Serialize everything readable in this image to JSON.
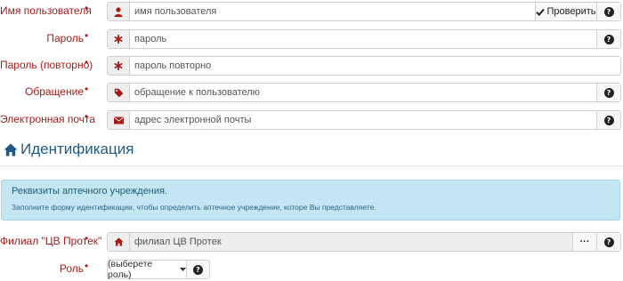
{
  "colors": {
    "label": "#a31d1d",
    "section_title": "#1f5a8a",
    "alert_bg": "#c4e6f3"
  },
  "fields": {
    "username": {
      "label": "Имя пользователя",
      "required": "•",
      "placeholder": "имя пользователя",
      "icon": "user-icon",
      "check_label": "Проверить",
      "help": "?"
    },
    "password": {
      "label": "Пароль",
      "required": "•",
      "placeholder": "пароль",
      "icon": "asterisk-icon",
      "help": "?"
    },
    "password_repeat": {
      "label": "Пароль (повторно)",
      "required": "•",
      "placeholder": "пароль повторно",
      "icon": "asterisk-icon"
    },
    "salutation": {
      "label": "Обращение",
      "required": "•",
      "placeholder": "обращение к пользователю",
      "icon": "tag-icon",
      "help": "?"
    },
    "email": {
      "label": "Электронная почта",
      "required": "•",
      "placeholder": "адрес электронной почты",
      "icon": "envelope-icon",
      "help": "?"
    }
  },
  "section": {
    "title": "Идентификация",
    "icon": "home-icon"
  },
  "alert": {
    "title": "Реквизиты аптечного учреждения.",
    "text": "Заполните форму идентификации, чтобы определить аптечное учреждение, которе Вы представляете."
  },
  "branch": {
    "label": "Филиал \"ЦВ Протек\"",
    "required": "•",
    "placeholder": "филиал ЦВ Протек",
    "icon": "home-icon",
    "dots": "···",
    "help": "?"
  },
  "role": {
    "label": "Роль",
    "required": "•",
    "selected": "(выберете роль)",
    "help": "?"
  }
}
